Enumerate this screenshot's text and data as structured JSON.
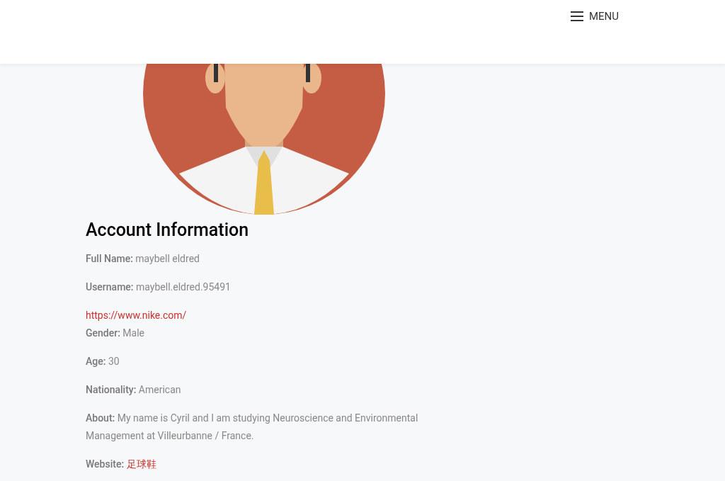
{
  "header": {
    "menu_label": "MENU"
  },
  "account": {
    "title": "Account Information",
    "paragraphs": [
      {
        "items": [
          {
            "kind": "field",
            "label": "Full Name:",
            "value": "maybell eldred"
          }
        ]
      },
      {
        "items": [
          {
            "kind": "field",
            "label": "Username:",
            "value": "maybell.eldred.95491"
          }
        ]
      },
      {
        "items": [
          {
            "kind": "link",
            "text": "https://www.nike.com/"
          },
          {
            "kind": "field",
            "label": "Gender:",
            "value": "Male"
          }
        ]
      },
      {
        "items": [
          {
            "kind": "field",
            "label": "Age:",
            "value": "30"
          }
        ]
      },
      {
        "items": [
          {
            "kind": "field",
            "label": "Nationality:",
            "value": "American"
          }
        ]
      },
      {
        "items": [
          {
            "kind": "field",
            "label": "About:",
            "value": "My name is Cyril and I am studying Neuroscience and Environmental Management at Villeurbanne / France."
          }
        ]
      },
      {
        "items": [
          {
            "kind": "field_link",
            "label": "Website:",
            "value": "足球鞋"
          }
        ]
      }
    ]
  }
}
